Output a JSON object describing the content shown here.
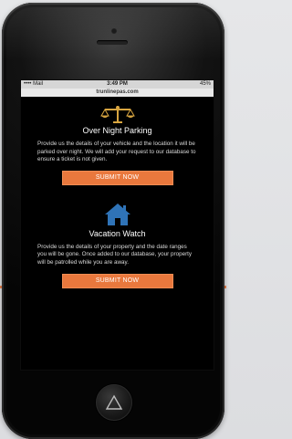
{
  "status": {
    "carrier": "•••• Mail",
    "time": "3:49 PM",
    "battery": "45%"
  },
  "browser": {
    "url": "trunlinepas.com"
  },
  "sections": [
    {
      "title": "Over Night Parking",
      "description": "Provide us the details of your vehicle and the location it will be parked over night. We will add your request to our database to ensure a ticket is not given.",
      "button": "SUBMIT NOW",
      "icon": "scales-icon"
    },
    {
      "title": "Vacation Watch",
      "description": "Provide us the details of your property and the date ranges you will be gone. Once added to our database, your property will be patrolled while you are away.",
      "button": "SUBMIT NOW",
      "icon": "house-icon"
    }
  ],
  "colors": {
    "accent": "#e9783d",
    "icon_gold": "#d8a540",
    "icon_blue": "#2f73b7",
    "screen_bg": "#000000"
  }
}
